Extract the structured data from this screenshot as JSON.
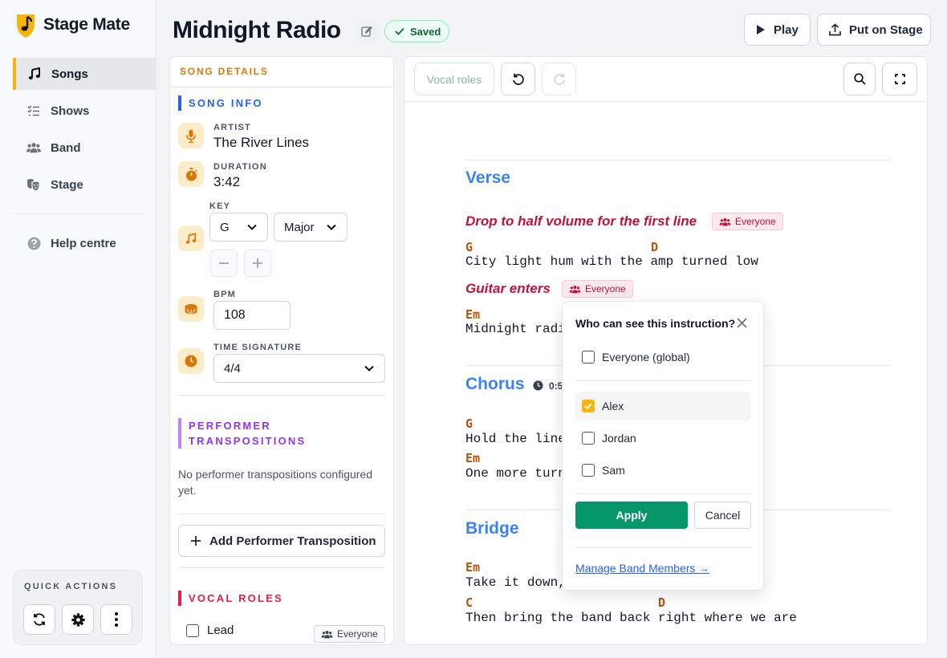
{
  "app": {
    "name": "Stage Mate",
    "brand_color": "#f5b50b"
  },
  "sidebar": {
    "items": [
      {
        "label": "Songs",
        "icon": "music-note-icon",
        "active": true
      },
      {
        "label": "Shows",
        "icon": "checklist-icon"
      },
      {
        "label": "Band",
        "icon": "people-icon"
      },
      {
        "label": "Stage",
        "icon": "theater-masks-icon"
      }
    ],
    "help": {
      "label": "Help centre",
      "icon": "question-circle-icon"
    },
    "quick_actions": {
      "label": "QUICK ACTIONS",
      "buttons": [
        "refresh-icon",
        "gear-icon",
        "more-vertical-icon"
      ]
    }
  },
  "header": {
    "title": "Midnight Radio",
    "saved_label": "Saved",
    "play_label": "Play",
    "stage_label": "Put on Stage"
  },
  "details": {
    "panel_title": "SONG DETAILS",
    "song_info_title": "SONG INFO",
    "artist_label": "ARTIST",
    "artist": "The River Lines",
    "duration_label": "DURATION",
    "duration": "3:42",
    "key_label": "KEY",
    "key": "G",
    "mode": "Major",
    "bpm_label": "BPM",
    "bpm": "108",
    "time_sig_label": "TIME SIGNATURE",
    "time_sig": "4/4",
    "transpositions_title": "PERFORMER TRANSPOSITIONS",
    "no_transpositions": "No performer transpositions configured yet.",
    "add_transposition": "Add Performer Transposition",
    "vocal_roles_title": "VOCAL ROLES",
    "lead_label": "Lead",
    "lead_badge": "Everyone"
  },
  "editor": {
    "toolbar": {
      "vocal_roles": "Vocal roles"
    },
    "sections": [
      {
        "name": "Verse",
        "instruction1": {
          "text": "Drop to half volume for the first line",
          "badge": "Everyone"
        },
        "line1": {
          "chords": [
            "G",
            "D"
          ],
          "lyric": "City light hum with the amp turned low"
        },
        "instruction2": {
          "text": "Guitar enters",
          "badge": "Everyone"
        },
        "line2": {
          "chords": [
            "Em"
          ],
          "lyric": "Midnight radi"
        }
      },
      {
        "name": "Chorus",
        "time": "0:5",
        "line1": {
          "chords": [
            "G"
          ],
          "lyric": "Hold the line"
        },
        "line2": {
          "chords": [
            "Em"
          ],
          "lyric": "One more turn"
        }
      },
      {
        "name": "Bridge",
        "line1": {
          "chords": [
            "Em"
          ],
          "lyric": "Take it down,"
        },
        "line2": {
          "chords": [
            "C",
            "D"
          ],
          "lyric": "Then bring the band back right where we are"
        }
      }
    ]
  },
  "popover": {
    "title": "Who can see this instruction?",
    "everyone_label": "Everyone (global)",
    "everyone_checked": false,
    "members": [
      {
        "name": "Alex",
        "checked": true
      },
      {
        "name": "Jordan",
        "checked": false
      },
      {
        "name": "Sam",
        "checked": false
      }
    ],
    "apply": "Apply",
    "cancel": "Cancel",
    "manage_link": "Manage Band Members →"
  },
  "colors": {
    "section_heading": "#3b82f6",
    "instruction": "#be123c",
    "chord": "#b45309",
    "apply_button": "#059669",
    "song_info_accent": "#2563eb",
    "transpositions_accent": "#9333ea",
    "vocal_roles_accent": "#e11d48",
    "details_title": "#d97706"
  }
}
